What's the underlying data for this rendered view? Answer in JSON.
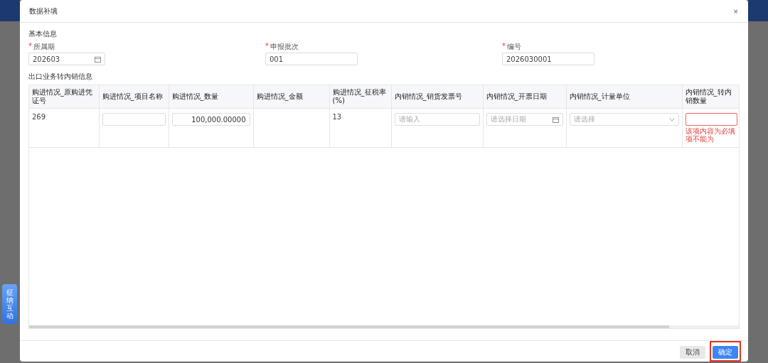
{
  "dialog": {
    "title": "数据补填",
    "close": "×"
  },
  "sections": [
    {
      "title": "基本信息"
    },
    {
      "title": "出口业务转内销信息"
    }
  ],
  "fields": [
    {
      "label": "所属期",
      "required_mark": "*",
      "kind": "date",
      "value": "202603"
    },
    {
      "label": "申报批次",
      "required_mark": "*",
      "kind": "text",
      "value": "001"
    },
    {
      "label": "编号",
      "required_mark": "*",
      "kind": "text",
      "value": "2026030001"
    }
  ],
  "table": {
    "columns": [
      "购进情况_原购进凭证号",
      "购进情况_项目名称",
      "购进情况_数量",
      "购进情况_金额",
      "购进情况_征税率(%)",
      "内销情况_销货发票号",
      "内销情况_开票日期",
      "内销情况_计量单位",
      "内销情况_转内销数量"
    ],
    "rows": [
      {
        "cells": [
          {
            "kind": "text",
            "value": "269"
          },
          {
            "kind": "input",
            "error": false
          },
          {
            "kind": "input",
            "value": "100,000.00000",
            "error": false
          },
          {
            "kind": "text"
          },
          {
            "kind": "text",
            "value": "13"
          },
          {
            "kind": "input",
            "placeholder": "请输入",
            "error": false
          },
          {
            "kind": "date",
            "placeholder": "请选择日期"
          },
          {
            "kind": "select",
            "placeholder": "请选择"
          },
          {
            "kind": "input",
            "error": true,
            "message": "该项内容为必填项不能为"
          }
        ]
      }
    ]
  },
  "buttons": [
    {
      "label": "取消",
      "primary": false,
      "highlighted": false
    },
    {
      "label": "确定",
      "primary": true,
      "highlighted": true
    }
  ],
  "side_tab": {
    "label": "征纳互动"
  }
}
